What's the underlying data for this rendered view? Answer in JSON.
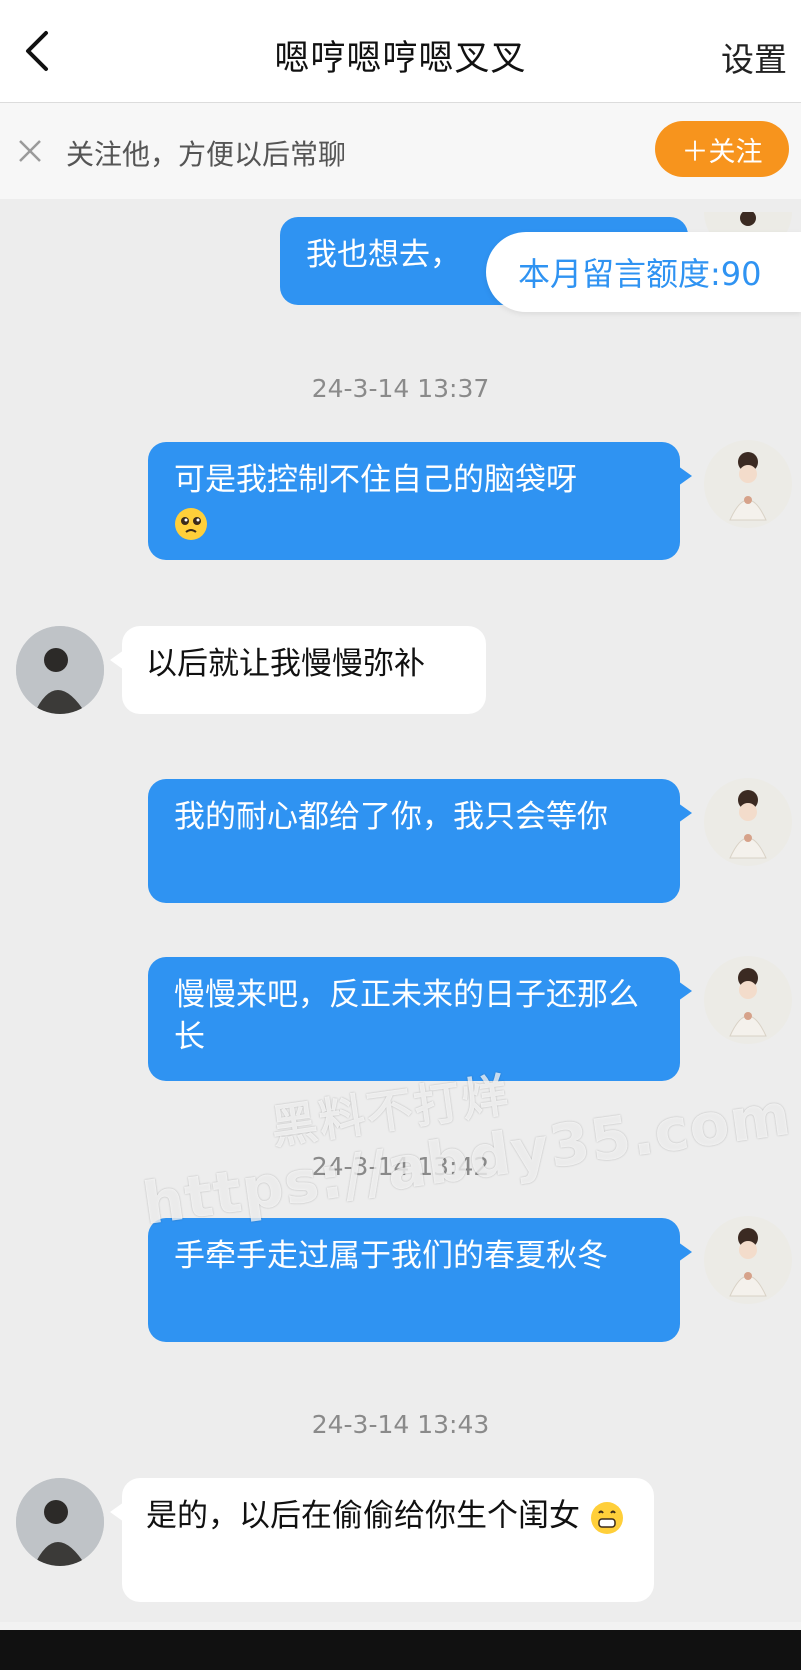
{
  "header": {
    "title": "嗯哼嗯哼嗯叉叉",
    "settings_label": "设置"
  },
  "follow_bar": {
    "tip": "关注他，方便以后常聊",
    "button_label": "＋关注"
  },
  "quota": {
    "text": "本月留言额度:90"
  },
  "messages": [
    {
      "side": "right",
      "text": "我也想去，"
    },
    {
      "side": "right",
      "text": "可是我控制不住自己的脑袋呀"
    },
    {
      "side": "left",
      "text": "以后就让我慢慢弥补"
    },
    {
      "side": "right",
      "text": "我的耐心都给了你，我只会等你"
    },
    {
      "side": "right",
      "text": "慢慢来吧，反正未来的日子还那么长"
    },
    {
      "side": "right",
      "text": "手牵手走过属于我们的春夏秋冬"
    },
    {
      "side": "left",
      "text": "是的，以后在偷偷给你生个闺女"
    }
  ],
  "timestamps": [
    "24-3-14 13:37",
    "24-3-14 13:42",
    "24-3-14 13:43"
  ],
  "watermark": {
    "line1": "黑料不打烊",
    "line2": "https://abdy35.com"
  },
  "colors": {
    "accent_blue": "#2f93f2",
    "follow_orange": "#f7941d"
  }
}
